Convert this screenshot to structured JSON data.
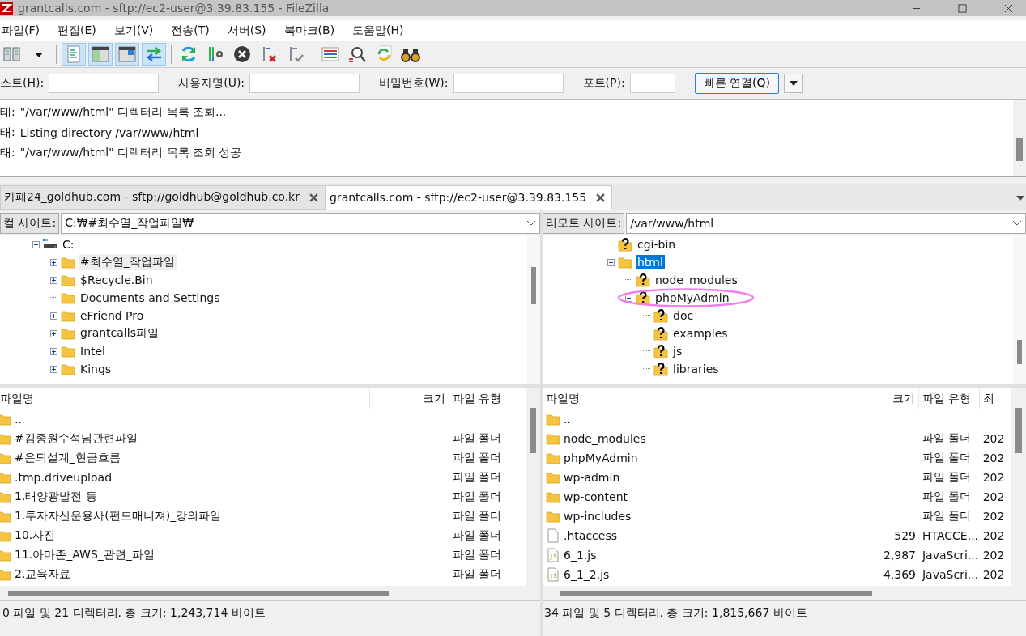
{
  "window": {
    "title": "grantcalls.com - sftp://ec2-user@3.39.83.155 - FileZilla"
  },
  "menu": [
    "파일(F)",
    "편집(E)",
    "보기(V)",
    "전송(T)",
    "서버(S)",
    "북마크(B)",
    "도움말(H)"
  ],
  "toolbar": [
    {
      "kind": "site-manager",
      "pressed": false
    },
    {
      "kind": "dropdown",
      "pressed": false
    },
    {
      "kind": "separator"
    },
    {
      "kind": "message-log",
      "pressed": true
    },
    {
      "kind": "local-tree",
      "pressed": true
    },
    {
      "kind": "remote-tree",
      "pressed": true
    },
    {
      "kind": "queue",
      "pressed": true
    },
    {
      "kind": "separator"
    },
    {
      "kind": "refresh",
      "pressed": false
    },
    {
      "kind": "filter",
      "pressed": false
    },
    {
      "kind": "cancel",
      "pressed": false
    },
    {
      "kind": "disconnect",
      "pressed": false
    },
    {
      "kind": "reconnect",
      "pressed": false
    },
    {
      "kind": "separator"
    },
    {
      "kind": "compare",
      "pressed": false
    },
    {
      "kind": "search",
      "pressed": false
    },
    {
      "kind": "sync",
      "pressed": false
    },
    {
      "kind": "find",
      "pressed": false
    }
  ],
  "quickconnect": {
    "fields": [
      {
        "label": "스트(H):"
      },
      {
        "label": "사용자명(U):"
      },
      {
        "label": "비밀번호(W):"
      },
      {
        "label": "포트(P):"
      }
    ],
    "button": "빠른 연결(Q)"
  },
  "log": [
    {
      "label": "태:",
      "text": "\"/var/www/html\" 디렉터리 목록 조회..."
    },
    {
      "label": "태:",
      "text": "Listing directory /var/www/html"
    },
    {
      "label": "태:",
      "text": "\"/var/www/html\" 디렉터리 목록 조회 성공"
    }
  ],
  "tabs": [
    {
      "label": "카페24_goldhub.com - sftp://goldhub@goldhub.co.kr",
      "selected": false
    },
    {
      "label": "grantcalls.com - sftp://ec2-user@3.39.83.155",
      "selected": true
    }
  ],
  "local": {
    "site_label": "컬 사이트:",
    "path": "C:₩#최수열_작업파일₩",
    "focused": false,
    "tree": [
      {
        "name": "C:",
        "kind": "drive",
        "expanded": true,
        "selected": false,
        "children": [
          {
            "name": "#최수열_작업파일",
            "kind": "folder",
            "expanded": false,
            "selected": true
          },
          {
            "name": "$Recycle.Bin",
            "kind": "folder",
            "expanded": false,
            "selected": false
          },
          {
            "name": "Documents and Settings",
            "kind": "folder",
            "selected": false
          },
          {
            "name": "eFriend Pro",
            "kind": "folder",
            "expanded": false,
            "selected": false
          },
          {
            "name": "grantcalls파일",
            "kind": "folder",
            "expanded": false,
            "selected": false
          },
          {
            "name": "Intel",
            "kind": "folder",
            "expanded": false,
            "selected": false
          },
          {
            "name": "Kings",
            "kind": "folder",
            "expanded": false,
            "selected": false
          }
        ]
      }
    ],
    "columns": [
      "파일명",
      "크기",
      "파일 유형"
    ],
    "rows": [
      {
        "name": "..",
        "kind": "folder"
      },
      {
        "name": "#김종원수석님관련파일",
        "kind": "folder",
        "type": "파일 폴더"
      },
      {
        "name": "#은퇴설계_현금흐름",
        "kind": "folder",
        "type": "파일 폴더"
      },
      {
        "name": ".tmp.driveupload",
        "kind": "folder",
        "type": "파일 폴더"
      },
      {
        "name": "1.태양광발전 등",
        "kind": "folder",
        "type": "파일 폴더"
      },
      {
        "name": "1.투자자산운용사(펀드매니져)_강의파일",
        "kind": "folder",
        "type": "파일 폴더"
      },
      {
        "name": "10.사진",
        "kind": "folder",
        "type": "파일 폴더"
      },
      {
        "name": "11.아마존_AWS_관련_파일",
        "kind": "folder",
        "type": "파일 폴더"
      },
      {
        "name": "2.교육자료",
        "kind": "folder",
        "type": "파일 폴더"
      }
    ],
    "status": "0 파일 및 21 디렉터리. 총 크기: 1,243,714 바이트"
  },
  "remote": {
    "site_label": "리모트 사이트:",
    "path": "/var/www/html",
    "focused": true,
    "tree": [
      {
        "name": "cgi-bin",
        "kind": "unknown-folder",
        "selected": false
      },
      {
        "name": "html",
        "kind": "folder",
        "expanded": true,
        "selected": true,
        "children": [
          {
            "name": "node_modules",
            "kind": "unknown-folder",
            "selected": false
          },
          {
            "name": "phpMyAdmin",
            "kind": "unknown-folder",
            "expanded": true,
            "selected": false,
            "children": [
              {
                "name": "doc",
                "kind": "unknown-folder",
                "selected": false
              },
              {
                "name": "examples",
                "kind": "unknown-folder",
                "selected": false
              },
              {
                "name": "js",
                "kind": "unknown-folder",
                "selected": false
              },
              {
                "name": "libraries",
                "kind": "unknown-folder",
                "selected": false
              }
            ]
          }
        ]
      }
    ],
    "columns": [
      "파일명",
      "크기",
      "파일 유형",
      "최"
    ],
    "rows": [
      {
        "name": "..",
        "kind": "folder"
      },
      {
        "name": "node_modules",
        "kind": "folder",
        "type": "파일 폴더",
        "date": "202"
      },
      {
        "name": "phpMyAdmin",
        "kind": "folder",
        "type": "파일 폴더",
        "date": "202"
      },
      {
        "name": "wp-admin",
        "kind": "folder",
        "type": "파일 폴더",
        "date": "202"
      },
      {
        "name": "wp-content",
        "kind": "folder",
        "type": "파일 폴더",
        "date": "202"
      },
      {
        "name": "wp-includes",
        "kind": "folder",
        "type": "파일 폴더",
        "date": "202"
      },
      {
        "name": ".htaccess",
        "kind": "file",
        "size": "529",
        "type": "HTACCE...",
        "date": "202"
      },
      {
        "name": "6_1.js",
        "kind": "js",
        "size": "2,987",
        "type": "JavaScri...",
        "date": "202"
      },
      {
        "name": "6_1_2.js",
        "kind": "js",
        "size": "4,369",
        "type": "JavaScri...",
        "date": "202"
      }
    ],
    "status": "34 파일 및 5 디렉터리. 총 크기: 1,815,667 바이트"
  }
}
